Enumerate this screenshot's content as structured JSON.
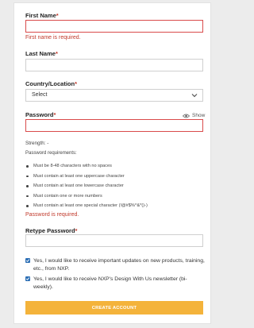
{
  "form": {
    "first_name": {
      "label": "First Name",
      "required_mark": "*",
      "value": "",
      "error": "First name is required."
    },
    "last_name": {
      "label": "Last Name",
      "required_mark": "*",
      "value": ""
    },
    "country": {
      "label": "Country/Location",
      "required_mark": "*",
      "selected": "Select"
    },
    "password": {
      "label": "Password",
      "required_mark": "*",
      "value": "",
      "show_label": "Show",
      "strength_label": "Strength: -",
      "requirements_title": "Password requirements:",
      "requirements": [
        "Must be 8-48 characters with no spaces",
        "Must contain at least one uppercase character",
        "Must contain at least one lowercase character",
        "Must contain one or more numbers",
        "Must contain at least one special character (!@#$%^&*()-)"
      ],
      "error": "Password is required."
    },
    "retype_password": {
      "label": "Retype Password",
      "required_mark": "*",
      "value": ""
    },
    "checkboxes": [
      {
        "checked": true,
        "text": "Yes, I would like to receive important updates on new products, training, etc., from NXP."
      },
      {
        "checked": true,
        "text": "Yes, I would like to receive NXP's Design With Us newsletter (bi-weekly)."
      }
    ],
    "submit_label": "CREATE ACCOUNT"
  },
  "colors": {
    "error": "#c0392b",
    "button": "#f4b33b",
    "checkbox": "#2d6fb5"
  }
}
